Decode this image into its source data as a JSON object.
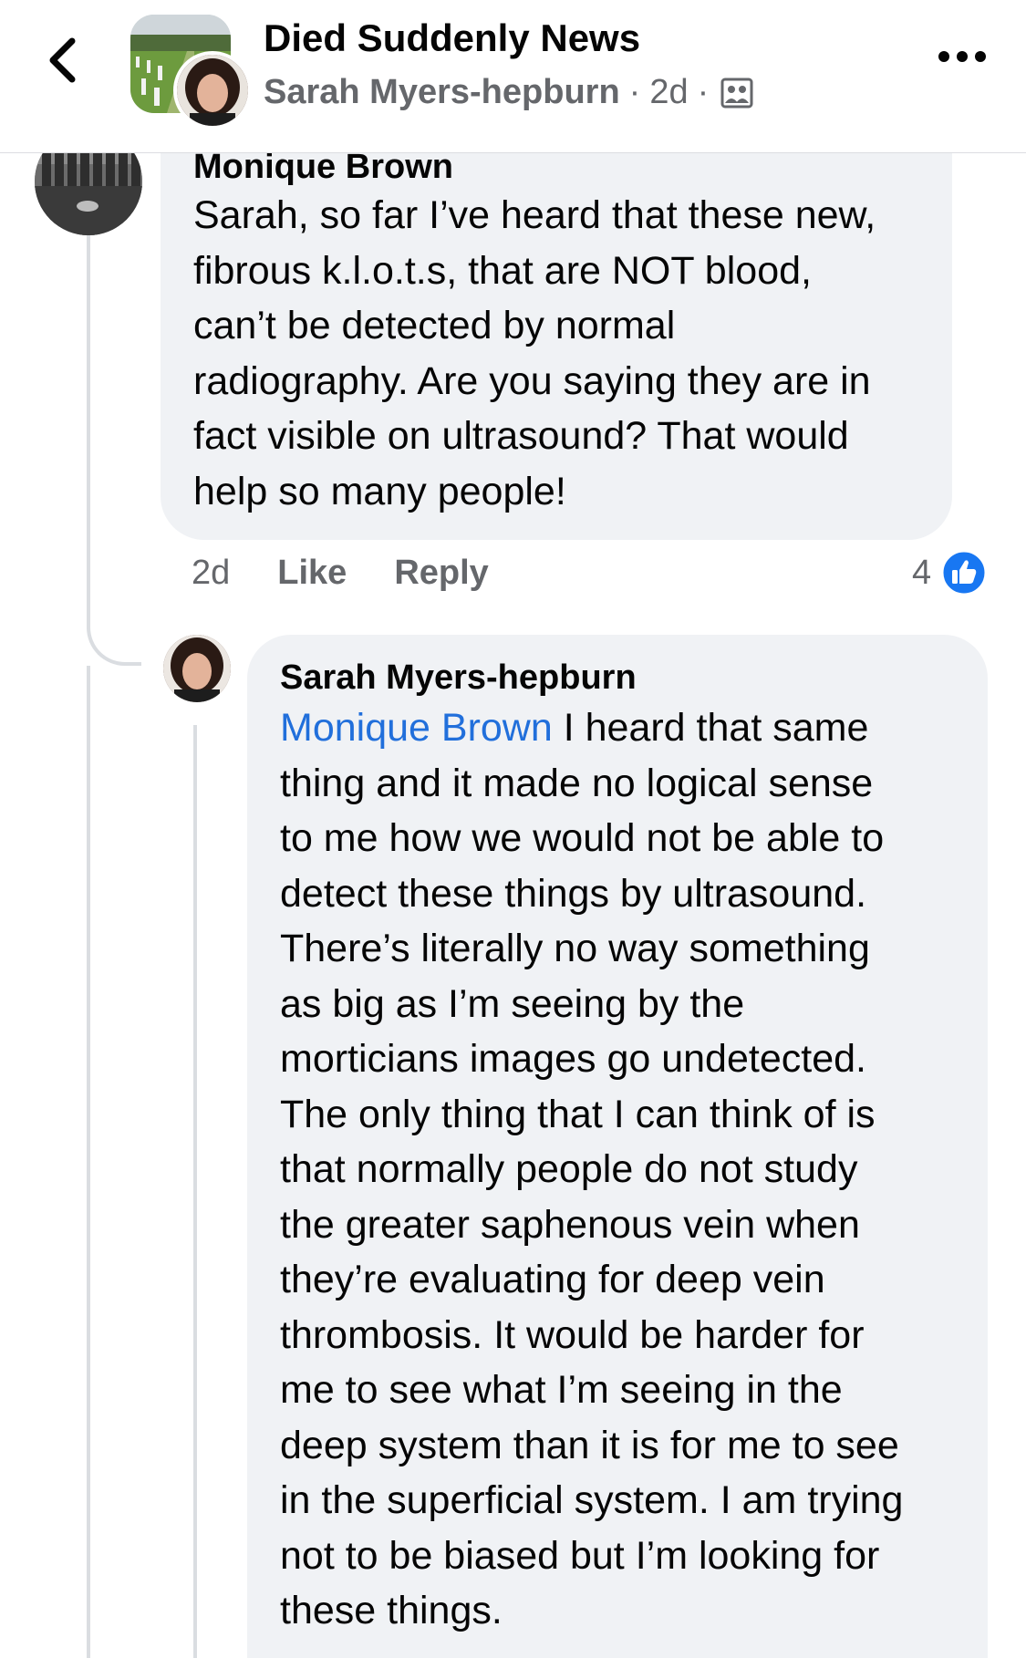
{
  "header": {
    "group_name": "Died Suddenly News",
    "poster_name": "Sarah Myers-hepburn",
    "separator": "·",
    "time": "2d",
    "back_icon": "chevron-left-icon",
    "more_icon": "ellipsis-horizontal-icon",
    "audience_icon": "group-audience-icon"
  },
  "comments": [
    {
      "author": "Monique Brown",
      "lines": [
        "Sarah, so far I’ve heard that these new,",
        "fibrous k.l.o.t.s, that are NOT blood,",
        "can’t be detected by normal",
        "radiography. Are you saying they are in",
        "fact visible on ultrasound? That would",
        "help so many people!"
      ],
      "time": "2d",
      "like_label": "Like",
      "reply_label": "Reply",
      "reaction_count": "4",
      "reaction_icon": "like-thumb-icon"
    },
    {
      "author": "Sarah Myers-hepburn",
      "mention": "Monique Brown",
      "first_line_rest": " I heard that same",
      "lines": [
        "thing and it made no logical sense",
        "to me how we would not be able to",
        "detect these things by ultrasound.",
        "There’s literally no way something",
        "as big as I’m seeing by the",
        "morticians images go undetected.",
        "The only thing that I can think of is",
        "that normally people do not study",
        "the greater saphenous vein when",
        "they’re evaluating for deep vein",
        "thrombosis. It would be harder for",
        "me to see what I’m seeing in the",
        "deep system than it is for me to see",
        "in the superficial system. I am trying",
        "not to be biased but I’m looking for",
        "these things."
      ]
    }
  ],
  "colors": {
    "bubble": "#f0f2f5",
    "secondary_text": "#65676b",
    "mention": "#216fdb",
    "like_blue": "#1877f2",
    "thread_line": "#dadde1"
  }
}
